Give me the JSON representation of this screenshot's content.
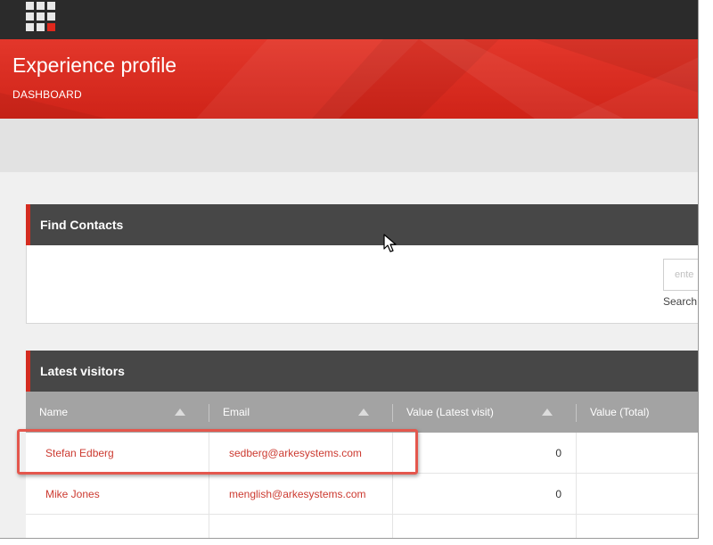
{
  "header": {
    "title": "Experience profile",
    "breadcrumb": "DASHBOARD"
  },
  "find_contacts": {
    "title": "Find Contacts",
    "search_placeholder": "ente",
    "search_link": "Search"
  },
  "latest_visitors": {
    "title": "Latest visitors",
    "columns": [
      "Name",
      "Email",
      "Value (Latest visit)",
      "Value (Total)"
    ],
    "rows": [
      {
        "name": "Stefan Edberg",
        "email": "sedberg@arkesystems.com",
        "value_latest": "0",
        "value_total": ""
      },
      {
        "name": "Mike Jones",
        "email": "menglish@arkesystems.com",
        "value_latest": "0",
        "value_total": ""
      }
    ]
  },
  "colors": {
    "accent": "#d42c20",
    "header_red": "#e3372b",
    "topbar": "#2b2b2b",
    "panel_header": "#474747",
    "table_header": "#a3a3a3",
    "link": "#cc3a30",
    "highlight": "#e4574d"
  },
  "icons": [
    "launchpad-grid-icon",
    "sort-ascending-icon",
    "mouse-pointer-icon"
  ]
}
